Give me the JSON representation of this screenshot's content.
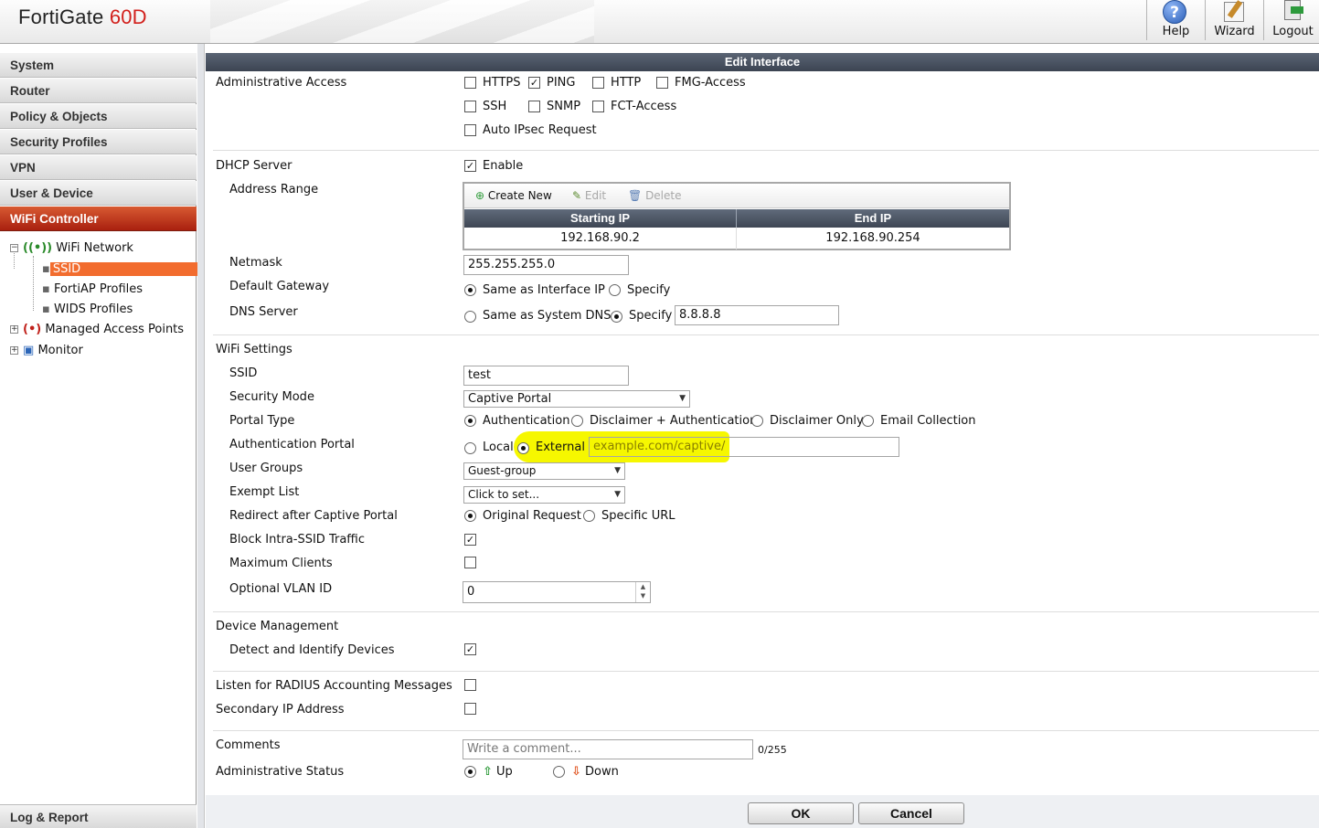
{
  "header": {
    "brand": "FortiGate",
    "model": "60D",
    "buttons": [
      {
        "label": "Help",
        "icon": "help-icon"
      },
      {
        "label": "Wizard",
        "icon": "wizard-icon"
      },
      {
        "label": "Logout",
        "icon": "logout-icon"
      }
    ]
  },
  "sidebar": {
    "nav": [
      "System",
      "Router",
      "Policy & Objects",
      "Security Profiles",
      "VPN",
      "User & Device",
      "WiFi Controller"
    ],
    "tree": {
      "wifi_network": "WiFi Network",
      "ssid": "SSID",
      "fortiap_profiles": "FortiAP Profiles",
      "wids_profiles": "WIDS Profiles",
      "managed_aps": "Managed Access Points",
      "monitor": "Monitor"
    },
    "bottom": "Log & Report"
  },
  "form": {
    "title": "Edit Interface",
    "admin_access": {
      "label": "Administrative Access",
      "options": [
        {
          "label": "HTTPS",
          "checked": false
        },
        {
          "label": "PING",
          "checked": true
        },
        {
          "label": "HTTP",
          "checked": false
        },
        {
          "label": "FMG-Access",
          "checked": false
        },
        {
          "label": "SSH",
          "checked": false
        },
        {
          "label": "SNMP",
          "checked": false
        },
        {
          "label": "FCT-Access",
          "checked": false
        },
        {
          "label": "Auto IPsec Request",
          "checked": false
        }
      ]
    },
    "dhcp": {
      "label": "DHCP Server",
      "enable": "Enable",
      "address_range": "Address Range",
      "toolbar": {
        "create": "Create New",
        "edit": "Edit",
        "delete": "Delete"
      },
      "columns": [
        "Starting IP",
        "End IP"
      ],
      "rows": [
        [
          "192.168.90.2",
          "192.168.90.254"
        ]
      ],
      "netmask_label": "Netmask",
      "netmask": "255.255.255.0",
      "gateway_label": "Default Gateway",
      "gateway_opt1": "Same as Interface IP",
      "gateway_opt2": "Specify",
      "dns_label": "DNS Server",
      "dns_opt1": "Same as System DNS",
      "dns_opt2": "Specify",
      "dns_value": "8.8.8.8"
    },
    "wifi": {
      "section": "WiFi Settings",
      "ssid_label": "SSID",
      "ssid": "test",
      "security_label": "Security Mode",
      "security": "Captive Portal",
      "portal_type_label": "Portal Type",
      "portal_types": [
        "Authentication",
        "Disclaimer + Authentication",
        "Disclaimer Only",
        "Email Collection"
      ],
      "auth_portal_label": "Authentication Portal",
      "auth_local": "Local",
      "auth_external": "External",
      "auth_url": "example.com/captive/",
      "user_groups_label": "User Groups",
      "user_groups": "Guest-group",
      "exempt_label": "Exempt List",
      "exempt": "Click to set...",
      "redirect_label": "Redirect after Captive Portal",
      "redirect_opt1": "Original Request",
      "redirect_opt2": "Specific URL",
      "block_label": "Block Intra-SSID Traffic",
      "max_clients_label": "Maximum Clients",
      "vlan_label": "Optional VLAN ID",
      "vlan": "0"
    },
    "device_mgmt": {
      "section": "Device Management",
      "detect_label": "Detect and Identify Devices"
    },
    "radius_label": "Listen for RADIUS Accounting Messages",
    "secondary_ip_label": "Secondary IP Address",
    "comments": {
      "label": "Comments",
      "placeholder": "Write a comment...",
      "count": "0/255"
    },
    "admin_status": {
      "label": "Administrative Status",
      "up": "Up",
      "down": "Down"
    },
    "buttons": {
      "ok": "OK",
      "cancel": "Cancel"
    }
  },
  "colors": {
    "accent": "#a9200f",
    "selected": "#f26c2e",
    "highlight": "#f6f700",
    "titlebar": "#3c4452"
  }
}
